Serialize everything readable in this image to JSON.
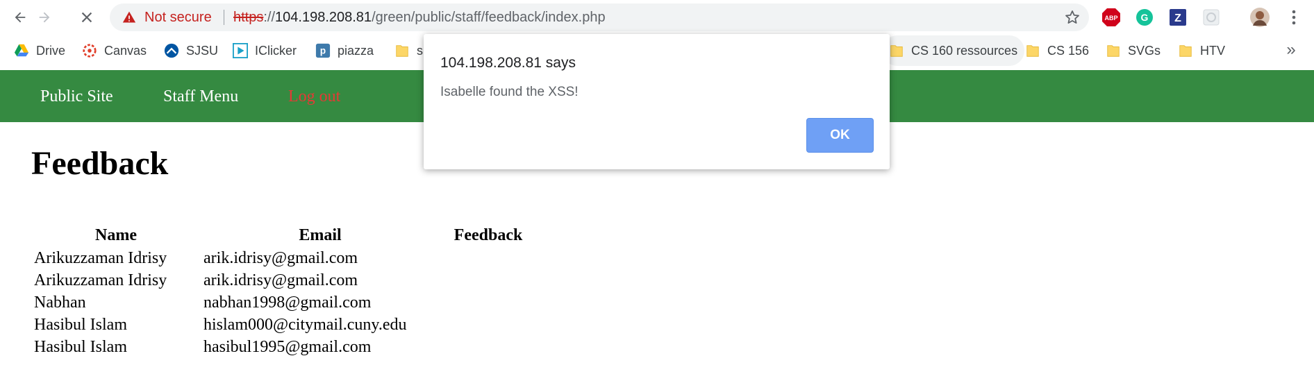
{
  "browser": {
    "security_label": "Not secure",
    "url": {
      "scheme": "https",
      "separator": "://",
      "host": "104.198.208.81",
      "path": "/green/public/staff/feedback/index.php"
    },
    "extensions": [
      "abp-icon",
      "grammarly-icon",
      "zotero-icon",
      "extension-icon",
      "profile-avatar"
    ],
    "bookmarks": [
      {
        "label": "Drive",
        "icon": "drive-icon"
      },
      {
        "label": "Canvas",
        "icon": "canvas-icon"
      },
      {
        "label": "SJSU",
        "icon": "sjsu-icon"
      },
      {
        "label": "IClicker",
        "icon": "iclicker-icon"
      },
      {
        "label": "piazza",
        "icon": "piazza-icon"
      },
      {
        "label": "s",
        "icon": "folder-icon"
      },
      {
        "label": "CS 160 ressources",
        "icon": "folder-icon"
      },
      {
        "label": "CS 156",
        "icon": "folder-icon"
      },
      {
        "label": "SVGs",
        "icon": "folder-icon"
      },
      {
        "label": "HTV",
        "icon": "folder-icon"
      }
    ],
    "bookmarks_more": "»"
  },
  "nav": {
    "public_site": "Public Site",
    "staff_menu": "Staff Menu",
    "logout": "Log out"
  },
  "page": {
    "title": "Feedback",
    "table": {
      "headers": [
        "Name",
        "Email",
        "Feedback"
      ],
      "rows": [
        [
          "Arikuzzaman Idrisy",
          "arik.idrisy@gmail.com",
          ""
        ],
        [
          "Arikuzzaman Idrisy",
          "arik.idrisy@gmail.com",
          ""
        ],
        [
          "Nabhan",
          "nabhan1998@gmail.com",
          ""
        ],
        [
          "Hasibul Islam",
          "hislam000@citymail.cuny.edu",
          ""
        ],
        [
          "Hasibul Islam",
          "hasibul1995@gmail.com",
          ""
        ]
      ]
    }
  },
  "dialog": {
    "title": "104.198.208.81 says",
    "message": "Isabelle found the XSS!",
    "ok_label": "OK"
  },
  "colors": {
    "navbar": "#358a41",
    "logout": "#e53935",
    "ok_button": "#6fa0f5",
    "not_secure": "#c5221f"
  }
}
